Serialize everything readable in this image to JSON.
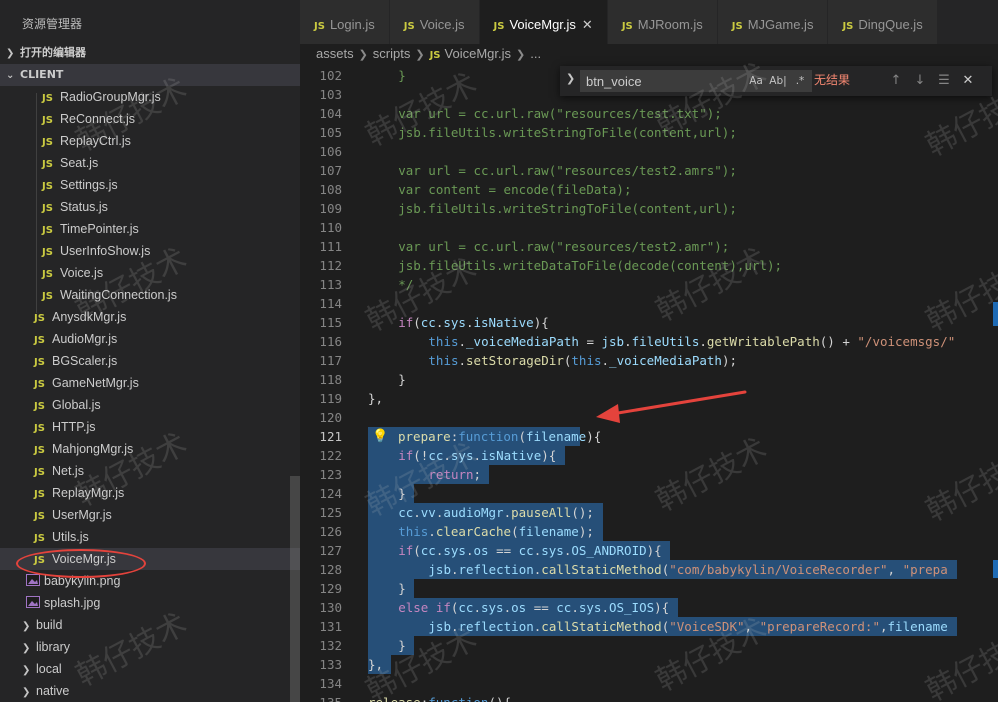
{
  "sidebar": {
    "title": "资源管理器",
    "sections": {
      "open_editors": "打开的编辑器",
      "client": "CLIENT"
    },
    "items": [
      {
        "label": "RadioGroupMgr.js",
        "kind": "js",
        "level": 2
      },
      {
        "label": "ReConnect.js",
        "kind": "js",
        "level": 2
      },
      {
        "label": "ReplayCtrl.js",
        "kind": "js",
        "level": 2
      },
      {
        "label": "Seat.js",
        "kind": "js",
        "level": 2
      },
      {
        "label": "Settings.js",
        "kind": "js",
        "level": 2
      },
      {
        "label": "Status.js",
        "kind": "js",
        "level": 2
      },
      {
        "label": "TimePointer.js",
        "kind": "js",
        "level": 2
      },
      {
        "label": "UserInfoShow.js",
        "kind": "js",
        "level": 2
      },
      {
        "label": "Voice.js",
        "kind": "js",
        "level": 2
      },
      {
        "label": "WaitingConnection.js",
        "kind": "js",
        "level": 2
      },
      {
        "label": "AnysdkMgr.js",
        "kind": "js",
        "level": 1
      },
      {
        "label": "AudioMgr.js",
        "kind": "js",
        "level": 1
      },
      {
        "label": "BGScaler.js",
        "kind": "js",
        "level": 1
      },
      {
        "label": "GameNetMgr.js",
        "kind": "js",
        "level": 1
      },
      {
        "label": "Global.js",
        "kind": "js",
        "level": 1
      },
      {
        "label": "HTTP.js",
        "kind": "js",
        "level": 1
      },
      {
        "label": "MahjongMgr.js",
        "kind": "js",
        "level": 1
      },
      {
        "label": "Net.js",
        "kind": "js",
        "level": 1
      },
      {
        "label": "ReplayMgr.js",
        "kind": "js",
        "level": 1
      },
      {
        "label": "UserMgr.js",
        "kind": "js",
        "level": 1
      },
      {
        "label": "Utils.js",
        "kind": "js",
        "level": 1
      },
      {
        "label": "VoiceMgr.js",
        "kind": "js",
        "level": 1,
        "selected": true
      },
      {
        "label": "babykylin.png",
        "kind": "img",
        "level": 1
      },
      {
        "label": "splash.jpg",
        "kind": "img",
        "level": 1
      },
      {
        "label": "build",
        "kind": "folder",
        "level": 0
      },
      {
        "label": "library",
        "kind": "folder",
        "level": 0
      },
      {
        "label": "local",
        "kind": "folder",
        "level": 0
      },
      {
        "label": "native",
        "kind": "folder",
        "level": 0
      }
    ],
    "badge_js": "JS"
  },
  "tabs": [
    {
      "label": "Login.js",
      "active": false
    },
    {
      "label": "Voice.js",
      "active": false
    },
    {
      "label": "VoiceMgr.js",
      "active": true
    },
    {
      "label": "MJRoom.js",
      "active": false
    },
    {
      "label": "MJGame.js",
      "active": false
    },
    {
      "label": "DingQue.js",
      "active": false
    }
  ],
  "breadcrumb": {
    "parts": [
      "assets",
      "scripts",
      "VoiceMgr.js",
      "..."
    ]
  },
  "find": {
    "value": "btn_voice",
    "opt_case": "Aa",
    "opt_word": "Ab|",
    "opt_regex": ".*",
    "result": "无结果"
  },
  "watermark": "韩仔技术",
  "colors": {
    "selection": "#264f78",
    "annotation": "#e4433c",
    "keyword": "#569cd6",
    "string": "#ce9178",
    "comment": "#6a9955"
  },
  "code_lines": [
    {
      "n": "102",
      "indent": 4,
      "tokens": [
        [
          "cm",
          "}"
        ]
      ]
    },
    {
      "n": "103",
      "indent": 0,
      "tokens": []
    },
    {
      "n": "104",
      "indent": 4,
      "tokens": [
        [
          "cm",
          "var url = cc.url.raw(\"resources/test.txt\");"
        ]
      ]
    },
    {
      "n": "105",
      "indent": 4,
      "tokens": [
        [
          "cm",
          "jsb.fileUtils.writeStringToFile(content,url);"
        ]
      ]
    },
    {
      "n": "106",
      "indent": 0,
      "tokens": []
    },
    {
      "n": "107",
      "indent": 4,
      "tokens": [
        [
          "cm",
          "var url = cc.url.raw(\"resources/test2.amrs\");"
        ]
      ]
    },
    {
      "n": "108",
      "indent": 4,
      "tokens": [
        [
          "cm",
          "var content = encode(fileData);"
        ]
      ]
    },
    {
      "n": "109",
      "indent": 4,
      "tokens": [
        [
          "cm",
          "jsb.fileUtils.writeStringToFile(content,url);"
        ]
      ]
    },
    {
      "n": "110",
      "indent": 0,
      "tokens": []
    },
    {
      "n": "111",
      "indent": 4,
      "tokens": [
        [
          "cm",
          "var url = cc.url.raw(\"resources/test2.amr\");"
        ]
      ]
    },
    {
      "n": "112",
      "indent": 4,
      "tokens": [
        [
          "cm",
          "jsb.fileUtils.writeDataToFile(decode(content),url);"
        ]
      ]
    },
    {
      "n": "113",
      "indent": 4,
      "tokens": [
        [
          "cm",
          "*/"
        ]
      ]
    },
    {
      "n": "114",
      "indent": 0,
      "tokens": []
    },
    {
      "n": "115",
      "indent": 4,
      "tokens": [
        [
          "ctl",
          "if"
        ],
        [
          "pl",
          "("
        ],
        [
          "id",
          "cc"
        ],
        [
          "pl",
          "."
        ],
        [
          "id",
          "sys"
        ],
        [
          "pl",
          "."
        ],
        [
          "id",
          "isNative"
        ],
        [
          "pl",
          "){"
        ]
      ]
    },
    {
      "n": "116",
      "indent": 8,
      "tokens": [
        [
          "kw",
          "this"
        ],
        [
          "pl",
          "."
        ],
        [
          "id",
          "_voiceMediaPath"
        ],
        [
          "pl",
          " = "
        ],
        [
          "id",
          "jsb"
        ],
        [
          "pl",
          "."
        ],
        [
          "id",
          "fileUtils"
        ],
        [
          "pl",
          "."
        ],
        [
          "fn",
          "getWritablePath"
        ],
        [
          "pl",
          "() + "
        ],
        [
          "str",
          "\"/voicemsgs/\""
        ]
      ]
    },
    {
      "n": "117",
      "indent": 8,
      "tokens": [
        [
          "kw",
          "this"
        ],
        [
          "pl",
          "."
        ],
        [
          "fn",
          "setStorageDir"
        ],
        [
          "pl",
          "("
        ],
        [
          "kw",
          "this"
        ],
        [
          "pl",
          "."
        ],
        [
          "id",
          "_voiceMediaPath"
        ],
        [
          "pl",
          ");"
        ]
      ]
    },
    {
      "n": "118",
      "indent": 4,
      "tokens": [
        [
          "pl",
          "}"
        ]
      ]
    },
    {
      "n": "119",
      "indent": 0,
      "tokens": [
        [
          "pl",
          "},"
        ]
      ]
    },
    {
      "n": "120",
      "indent": 0,
      "tokens": []
    },
    {
      "n": "121",
      "indent": 0,
      "tokens": [
        [
          "fn",
          "prepare"
        ],
        [
          "pl",
          ":"
        ],
        [
          "kw",
          "function"
        ],
        [
          "pl",
          "("
        ],
        [
          "id",
          "filename"
        ],
        [
          "pl",
          "){"
        ]
      ],
      "current": true,
      "bulb": true
    },
    {
      "n": "122",
      "indent": 4,
      "tokens": [
        [
          "ctl",
          "if"
        ],
        [
          "pl",
          "(!"
        ],
        [
          "id",
          "cc"
        ],
        [
          "pl",
          "."
        ],
        [
          "id",
          "sys"
        ],
        [
          "pl",
          "."
        ],
        [
          "id",
          "isNative"
        ],
        [
          "pl",
          "){"
        ]
      ]
    },
    {
      "n": "123",
      "indent": 8,
      "tokens": [
        [
          "ctl",
          "return"
        ],
        [
          "pl",
          ";"
        ]
      ]
    },
    {
      "n": "124",
      "indent": 4,
      "tokens": [
        [
          "pl",
          "}"
        ]
      ]
    },
    {
      "n": "125",
      "indent": 4,
      "tokens": [
        [
          "id",
          "cc"
        ],
        [
          "pl",
          "."
        ],
        [
          "id",
          "vv"
        ],
        [
          "pl",
          "."
        ],
        [
          "id",
          "audioMgr"
        ],
        [
          "pl",
          "."
        ],
        [
          "fn",
          "pauseAll"
        ],
        [
          "pl",
          "();"
        ]
      ]
    },
    {
      "n": "126",
      "indent": 4,
      "tokens": [
        [
          "kw",
          "this"
        ],
        [
          "pl",
          "."
        ],
        [
          "fn",
          "clearCache"
        ],
        [
          "pl",
          "("
        ],
        [
          "id",
          "filename"
        ],
        [
          "pl",
          ");"
        ]
      ]
    },
    {
      "n": "127",
      "indent": 4,
      "tokens": [
        [
          "ctl",
          "if"
        ],
        [
          "pl",
          "("
        ],
        [
          "id",
          "cc"
        ],
        [
          "pl",
          "."
        ],
        [
          "id",
          "sys"
        ],
        [
          "pl",
          "."
        ],
        [
          "id",
          "os"
        ],
        [
          "pl",
          " == "
        ],
        [
          "id",
          "cc"
        ],
        [
          "pl",
          "."
        ],
        [
          "id",
          "sys"
        ],
        [
          "pl",
          "."
        ],
        [
          "id",
          "OS_ANDROID"
        ],
        [
          "pl",
          "){"
        ]
      ]
    },
    {
      "n": "128",
      "indent": 8,
      "tokens": [
        [
          "id",
          "jsb"
        ],
        [
          "pl",
          "."
        ],
        [
          "id",
          "reflection"
        ],
        [
          "pl",
          "."
        ],
        [
          "fn",
          "callStaticMethod"
        ],
        [
          "pl",
          "("
        ],
        [
          "str",
          "\"com/babykylin/VoiceRecorder\""
        ],
        [
          "pl",
          ", "
        ],
        [
          "str",
          "\"prepa"
        ]
      ]
    },
    {
      "n": "129",
      "indent": 4,
      "tokens": [
        [
          "pl",
          "}"
        ]
      ]
    },
    {
      "n": "130",
      "indent": 4,
      "tokens": [
        [
          "ctl",
          "else if"
        ],
        [
          "pl",
          "("
        ],
        [
          "id",
          "cc"
        ],
        [
          "pl",
          "."
        ],
        [
          "id",
          "sys"
        ],
        [
          "pl",
          "."
        ],
        [
          "id",
          "os"
        ],
        [
          "pl",
          " == "
        ],
        [
          "id",
          "cc"
        ],
        [
          "pl",
          "."
        ],
        [
          "id",
          "sys"
        ],
        [
          "pl",
          "."
        ],
        [
          "id",
          "OS_IOS"
        ],
        [
          "pl",
          "){"
        ]
      ]
    },
    {
      "n": "131",
      "indent": 8,
      "tokens": [
        [
          "id",
          "jsb"
        ],
        [
          "pl",
          "."
        ],
        [
          "id",
          "reflection"
        ],
        [
          "pl",
          "."
        ],
        [
          "fn",
          "callStaticMethod"
        ],
        [
          "pl",
          "("
        ],
        [
          "str",
          "\"VoiceSDK\""
        ],
        [
          "pl",
          ", "
        ],
        [
          "str",
          "\"prepareRecord:\""
        ],
        [
          "pl",
          ","
        ],
        [
          "id",
          "filename"
        ]
      ]
    },
    {
      "n": "132",
      "indent": 4,
      "tokens": [
        [
          "pl",
          "}"
        ]
      ]
    },
    {
      "n": "133",
      "indent": 0,
      "tokens": [
        [
          "pl",
          "},"
        ]
      ]
    },
    {
      "n": "134",
      "indent": 0,
      "tokens": []
    },
    {
      "n": "135",
      "indent": 0,
      "tokens": [
        [
          "fn",
          "release"
        ],
        [
          "pl",
          ":"
        ],
        [
          "kw",
          "function"
        ],
        [
          "pl",
          "(){"
        ]
      ]
    }
  ]
}
